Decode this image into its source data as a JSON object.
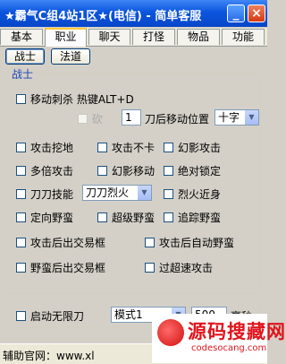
{
  "window": {
    "title": "★霸气C组4站1区★(电信) - 简单客服",
    "minimize": "_",
    "close": "×"
  },
  "tabs": [
    "基本",
    "职业",
    "聊天",
    "打怪",
    "物品",
    "功能"
  ],
  "subtabs": [
    "战士",
    "法道"
  ],
  "group": {
    "label": "战士",
    "move_label": "移动刺杀 热键ALT+D",
    "kan_label": "砍",
    "kan_value": "1",
    "after_knife": "刀后移动位置",
    "position_select": "十字",
    "options": [
      "攻击挖地",
      "攻击不卡",
      "幻影攻击",
      "多倍攻击",
      "幻影移动",
      "绝对锁定"
    ],
    "knife_skill_label": "刀刀技能",
    "knife_skill_select": "刀刀烈火",
    "fire_close": "烈火近身",
    "options2": [
      "定向野蛮",
      "超级野蛮",
      "追踪野蛮"
    ],
    "trade1": "攻击后出交易框",
    "trade2": "攻击后自动野蛮",
    "trade3": "野蛮后出交易框",
    "trade4": "过超速攻击"
  },
  "bottom": {
    "unlimited": "启动无限刀",
    "mode": "模式1",
    "speed": "500",
    "speed_label": "毫秒"
  },
  "status": "辅助官网：www.xl",
  "watermark": {
    "cn": "源码搜藏网",
    "en": "codesocang.com"
  }
}
